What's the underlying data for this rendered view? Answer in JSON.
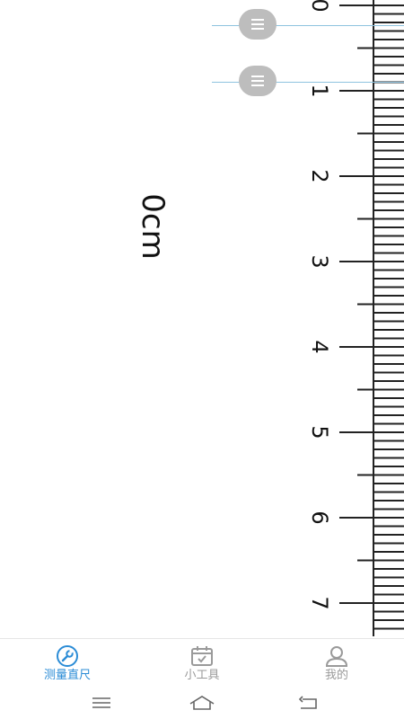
{
  "ruler": {
    "unit": "cm",
    "numbers": [
      "0",
      "1",
      "2",
      "3",
      "4",
      "5",
      "6",
      "7"
    ],
    "line_color": "#222222",
    "handle_line_color": "#8ec3df",
    "handle_color": "#bdbdbd"
  },
  "measurement": {
    "value_text": "0cm"
  },
  "handles": [
    {
      "name": "top-handle",
      "icon": "menu-lines-icon"
    },
    {
      "name": "bottom-handle",
      "icon": "menu-lines-icon"
    }
  ],
  "tabbar": {
    "accent_color": "#2b8cd6",
    "inactive_color": "#9a9a9a",
    "tabs": [
      {
        "label": "测量直尺",
        "icon": "wrench-icon",
        "active": true
      },
      {
        "label": "小工具",
        "icon": "calendar-check-icon",
        "active": false
      },
      {
        "label": "我的",
        "icon": "user-icon",
        "active": false
      }
    ]
  },
  "navbar": {
    "buttons": [
      {
        "icon": "menu-icon"
      },
      {
        "icon": "home-icon"
      },
      {
        "icon": "back-icon"
      }
    ]
  }
}
